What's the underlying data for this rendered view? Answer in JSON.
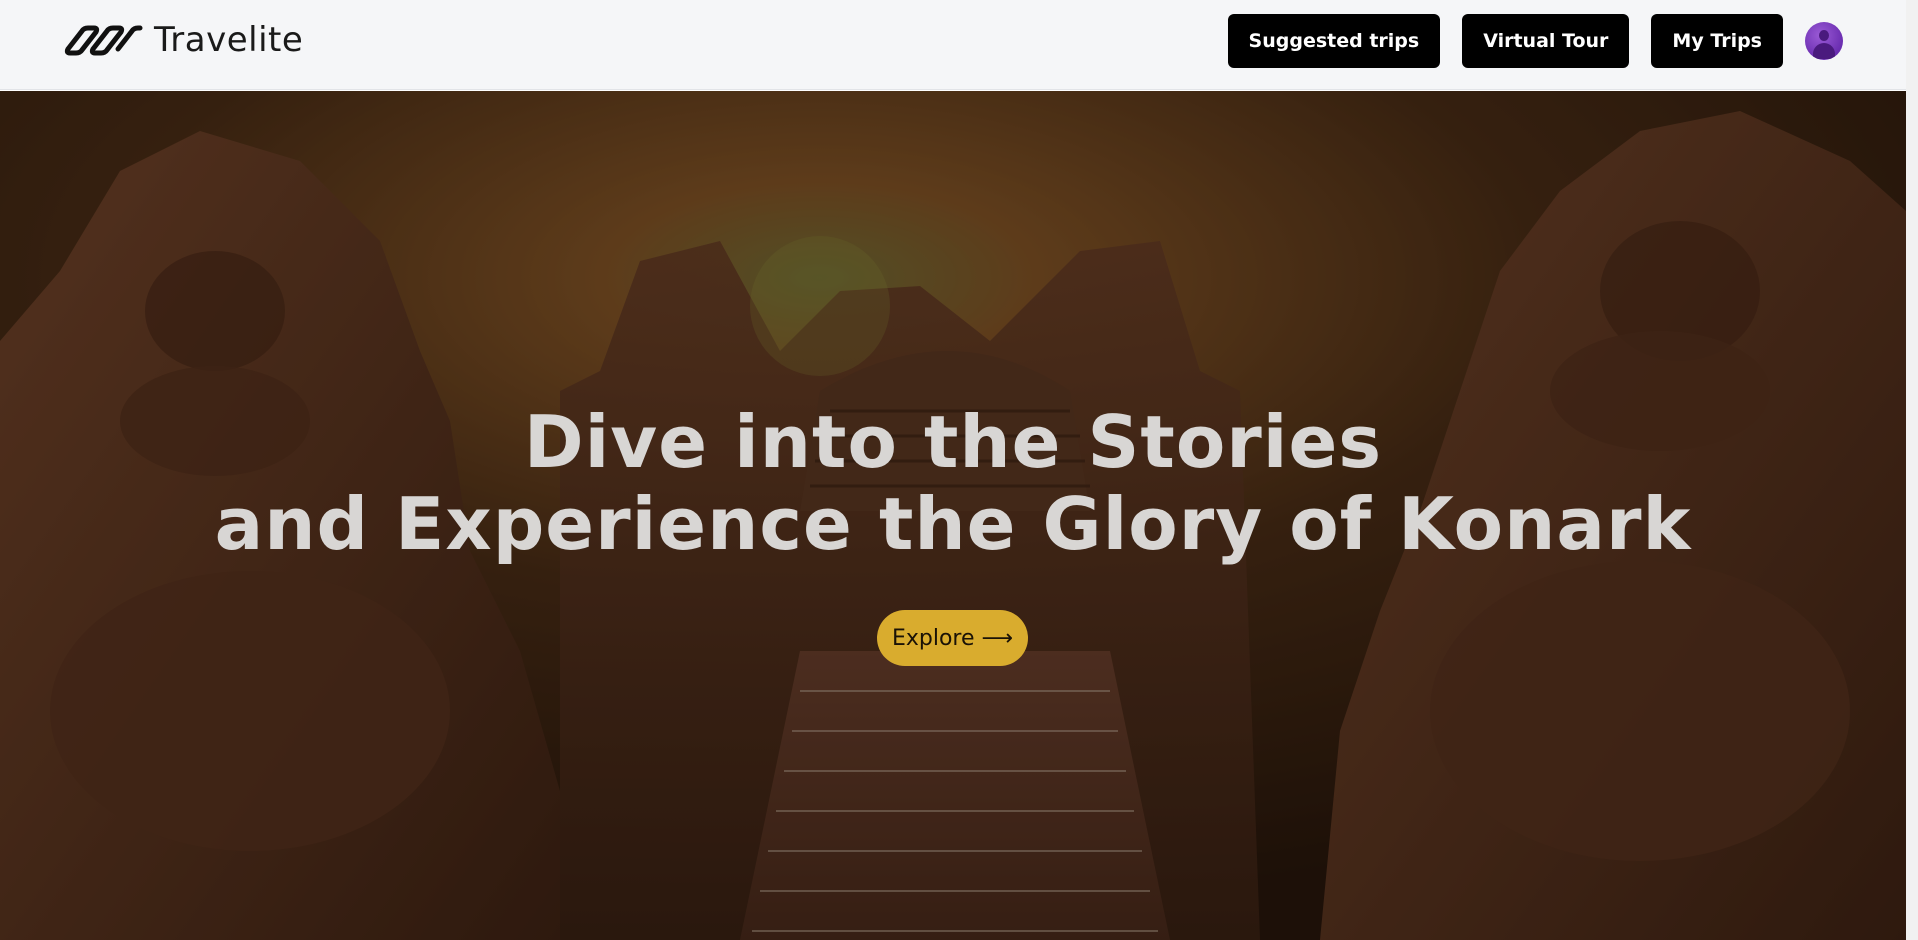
{
  "brand": {
    "name": "Travelite",
    "logo_icon": "infinity-chain-logo"
  },
  "nav": {
    "suggested_trips": "Suggested trips",
    "virtual_tour": "Virtual Tour",
    "my_trips": "My Trips",
    "avatar_icon": "user-avatar-icon"
  },
  "hero": {
    "headline_line1": "Dive into the Stories",
    "headline_line2": "and Experience the Glory of Konark",
    "explore_label": "Explore ⟶",
    "background_image": "konark-sun-temple-photo"
  },
  "colors": {
    "nav_background": "#f5f6f8",
    "button_black": "#000000",
    "explore_gold": "#d9ac2e",
    "headline_text": "#d8d6d4",
    "avatar_purple": "#7a3bc2"
  }
}
